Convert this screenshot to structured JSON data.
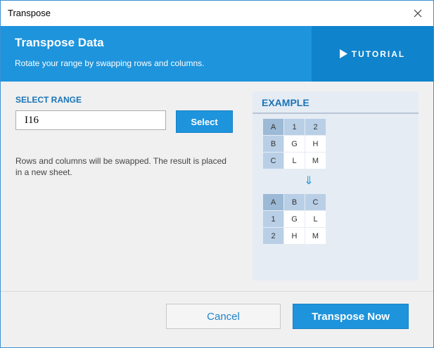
{
  "window": {
    "title": "Transpose"
  },
  "header": {
    "title": "Transpose Data",
    "subtitle": "Rotate your range by swapping rows and columns.",
    "tutorial_label": "TUTORIAL"
  },
  "form": {
    "select_range_label": "SELECT RANGE",
    "range_value": "I16",
    "select_button": "Select",
    "note": "Rows and columns will be swapped. The result is placed in a new sheet."
  },
  "example": {
    "title": "EXAMPLE",
    "before": [
      [
        "A",
        "1",
        "2"
      ],
      [
        "B",
        "G",
        "H"
      ],
      [
        "C",
        "L",
        "M"
      ]
    ],
    "arrow": "⇓",
    "after": [
      [
        "A",
        "B",
        "C"
      ],
      [
        "1",
        "G",
        "L"
      ],
      [
        "2",
        "H",
        "M"
      ]
    ]
  },
  "footer": {
    "cancel_button": "Cancel",
    "primary_button": "Transpose Now"
  },
  "colors": {
    "accent": "#1e94dc",
    "accent_dark": "#0f83cc",
    "label_blue": "#1a74b8",
    "example_bg": "#e6ecf4"
  },
  "icons": {
    "close": "close-icon",
    "tutorial": "play-icon",
    "arrow": "arrow-down-icon"
  }
}
